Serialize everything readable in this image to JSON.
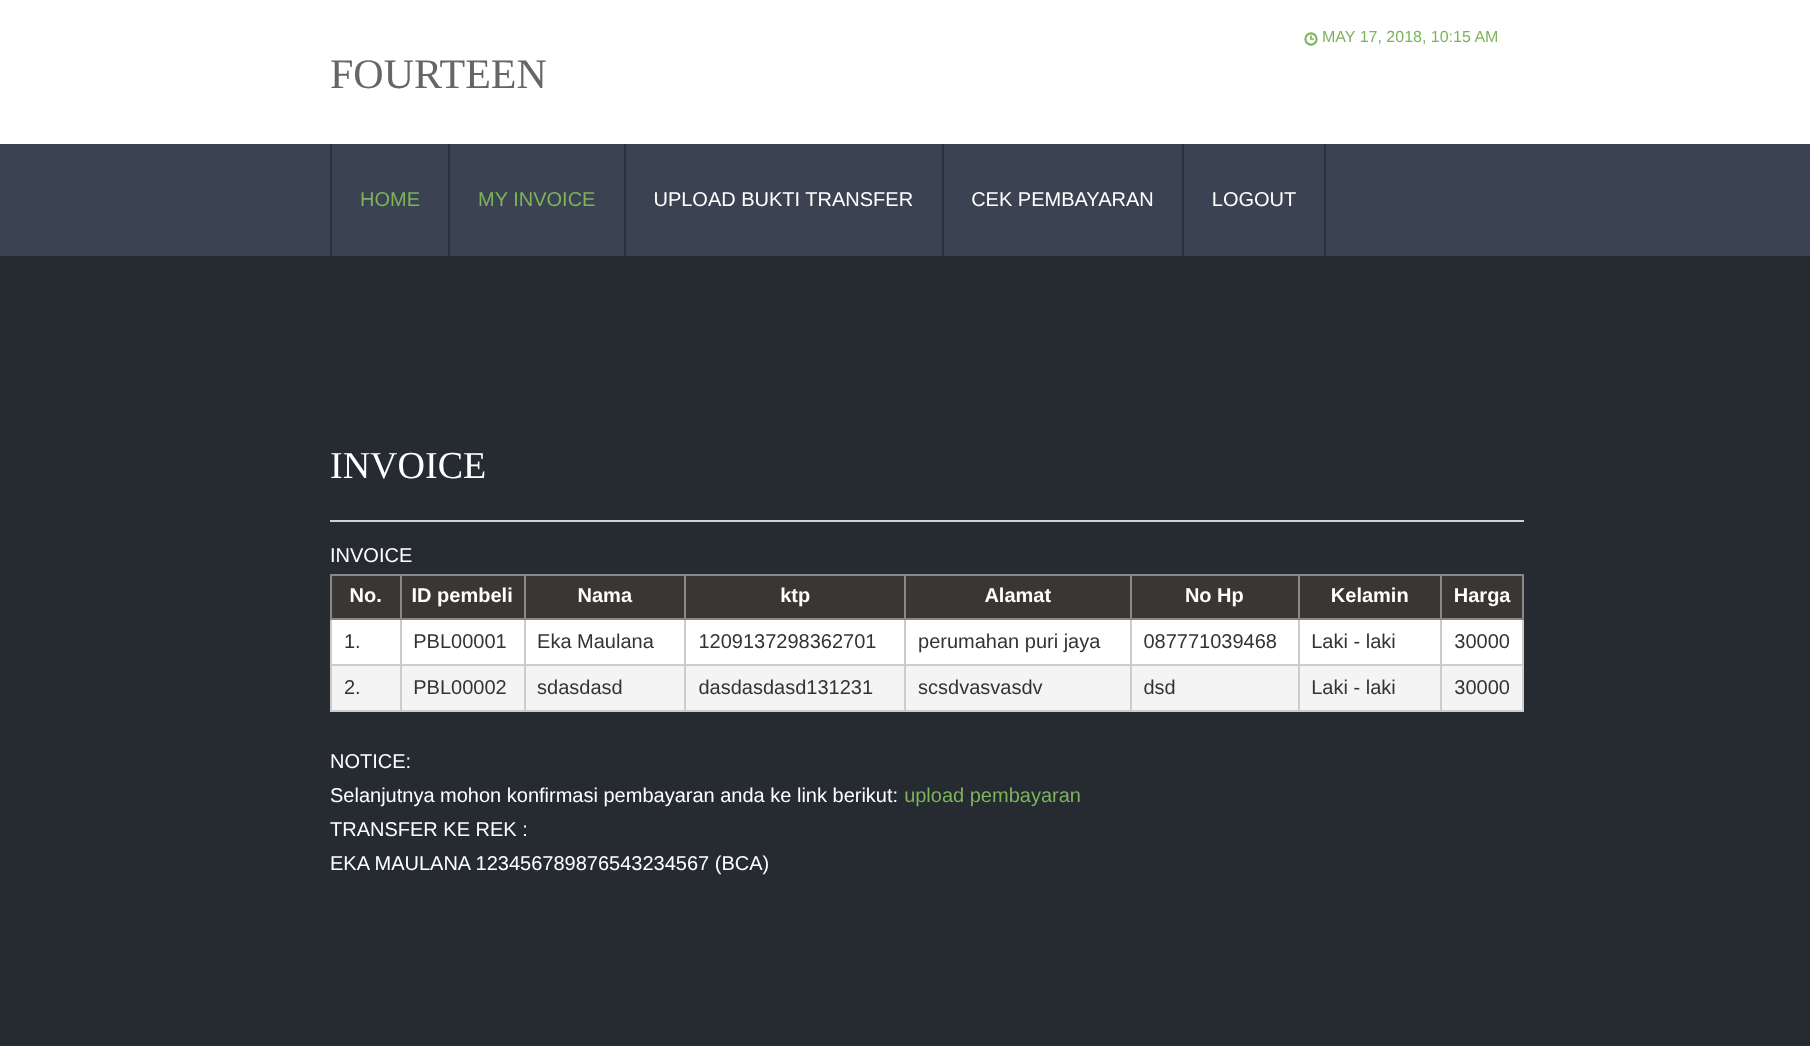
{
  "site": {
    "logo": "FOURTEEN",
    "datetime": "MAY 17, 2018, 10:15 AM"
  },
  "nav": [
    {
      "label": "HOME",
      "highlighted": true
    },
    {
      "label": "MY INVOICE",
      "highlighted": true
    },
    {
      "label": "UPLOAD BUKTI TRANSFER",
      "highlighted": false
    },
    {
      "label": "CEK PEMBAYARAN",
      "highlighted": false
    },
    {
      "label": "LOGOUT",
      "highlighted": false
    }
  ],
  "page_title": "INVOICE",
  "table": {
    "caption": "INVOICE",
    "columns": [
      "No.",
      "ID pembeli",
      "Nama",
      "ktp",
      "Alamat",
      "No Hp",
      "Kelamin",
      "Harga"
    ],
    "rows": [
      [
        "1.",
        "PBL00001",
        "Eka Maulana",
        "1209137298362701",
        "perumahan puri jaya",
        "087771039468",
        "Laki - laki",
        "30000"
      ],
      [
        "2.",
        "PBL00002",
        "sdasdasd",
        "dasdasdasd131231",
        "scsdvasvasdv",
        "dsd",
        "Laki - laki",
        "30000"
      ]
    ]
  },
  "notice": {
    "heading": "NOTICE:",
    "text": "Selanjutnya mohon konfirmasi pembayaran anda ke link berikut:",
    "link": "upload pembayaran",
    "transfer_label": "TRANSFER KE REK :",
    "account": "EKA MAULANA 123456789876543234567 (BCA)"
  }
}
